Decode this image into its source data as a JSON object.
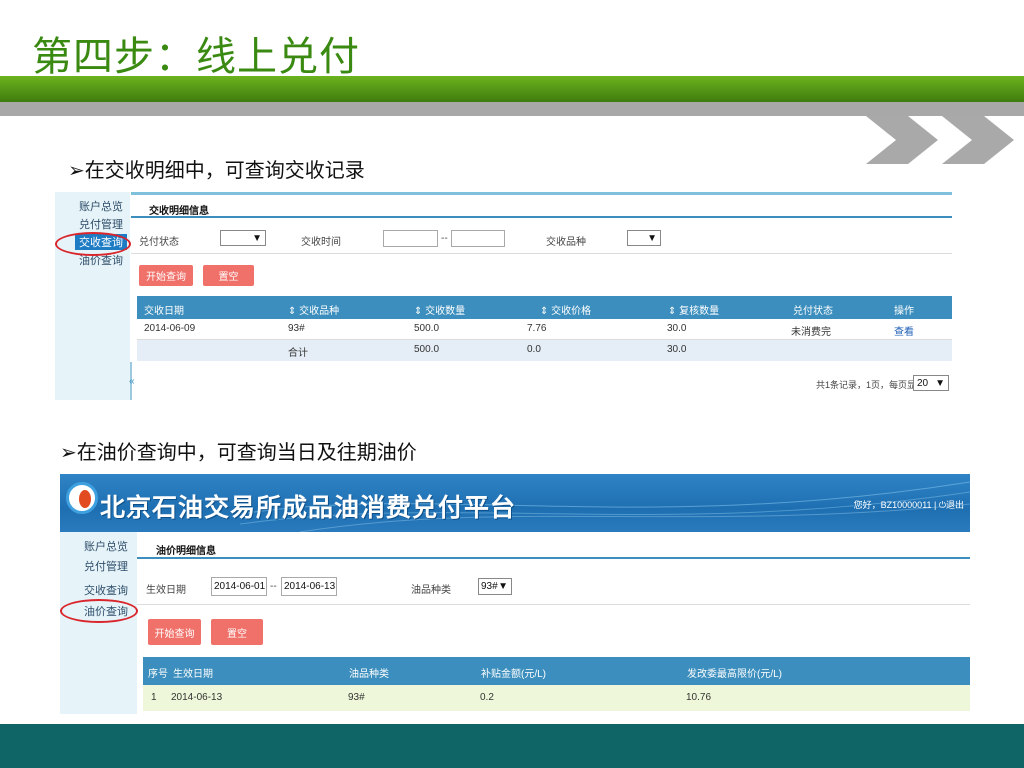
{
  "slide": {
    "title": "第四步：线上兑付",
    "bullet1": "➢在交收明细中，可查询交收记录",
    "bullet2": "➢在油价查询中，可查询当日及往期油价"
  },
  "screen1": {
    "sidebar": [
      "账户总览",
      "兑付管理",
      "交收查询",
      "油价查询"
    ],
    "tab": "交收明细信息",
    "filters": {
      "status_label": "兑付状态",
      "time_label": "交收时间",
      "time_sep": "--",
      "product_label": "交收品种"
    },
    "buttons": {
      "search": "开始查询",
      "reset": "置空"
    },
    "columns": [
      "交收日期",
      "⇕ 交收品种",
      "⇕ 交收数量",
      "⇕ 交收价格",
      "⇕ 复核数量",
      "兑付状态",
      "操作"
    ],
    "rows": [
      [
        "2014-06-09",
        "93#",
        "500.0",
        "7.76",
        "30.0",
        "未消费完",
        "查看"
      ]
    ],
    "total": [
      "",
      "合计",
      "500.0",
      "0.0",
      "30.0",
      "",
      ""
    ],
    "collapse": "«",
    "pager_text": "共1条记录，1页，每页显示",
    "page_size": "20"
  },
  "screen2": {
    "banner_title": "北京石油交易所成品油消费兑付平台",
    "user": "您好，BZ10000011 | ⏻退出",
    "sidebar": [
      "账户总览",
      "兑付管理",
      "交收查询",
      "油价查询"
    ],
    "tab": "油价明细信息",
    "filters": {
      "date_label": "生效日期",
      "date_from": "2014-06-01",
      "date_sep": "--",
      "date_to": "2014-06-13",
      "product_label": "油品种类",
      "product_value": "93#"
    },
    "buttons": {
      "search": "开始查询",
      "reset": "置空"
    },
    "columns": [
      "序号",
      "生效日期",
      "油品种类",
      "补贴金额(元/L)",
      "发改委最高限价(元/L)"
    ],
    "rows": [
      [
        "1",
        "2014-06-13",
        "93#",
        "0.2",
        "10.76"
      ]
    ]
  },
  "colors": {
    "title_green": "#3a8a12",
    "header_blue": "#3b8ebd",
    "button_red": "#f0706a",
    "footer_teal": "#0f6466",
    "highlight_ring": "#d9262c"
  }
}
